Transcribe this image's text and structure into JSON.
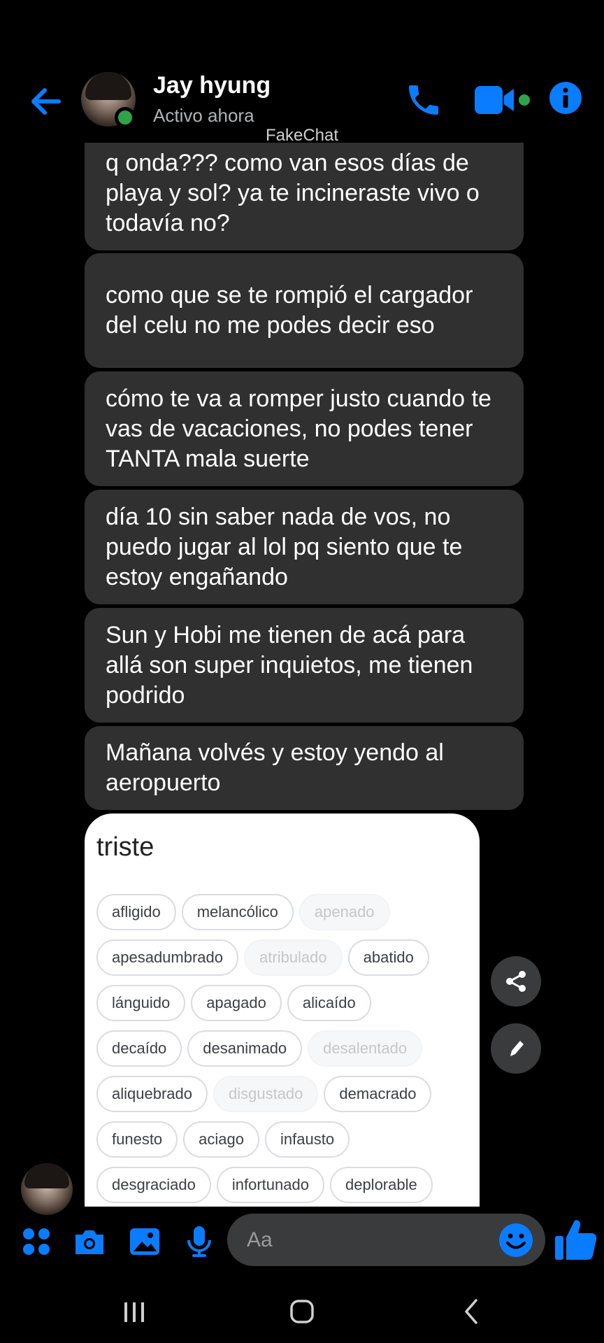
{
  "header": {
    "name": "Jay hyung",
    "status": "Activo ahora",
    "watermark": "FakeChat"
  },
  "messages": [
    {
      "text": "q onda??? como van esos días de playa y sol? ya te incineraste vivo o todavía no?"
    },
    {
      "text": "como que se te rompió el cargador del celu no me podes decir eso"
    },
    {
      "text": "cómo te va a romper justo cuando te vas de vacaciones, no podes tener TANTA mala suerte"
    },
    {
      "text": "día 10 sin saber nada de vos, no puedo jugar al lol pq siento que te estoy engañando"
    },
    {
      "text": "Sun y Hobi me tienen de acá para allá son super inquietos, me tienen podrido"
    },
    {
      "text": "Mañana volvés y estoy yendo al aeropuerto"
    }
  ],
  "card": {
    "title": "triste",
    "chips": [
      [
        "afligido",
        "melancólico",
        "apenado"
      ],
      [
        "apesadumbrado",
        "atribulado",
        "abatido"
      ],
      [
        "lánguido",
        "apagado",
        "alicaído"
      ],
      [
        "decaído",
        "desanimado",
        "desalentado"
      ],
      [
        "aliquebrado",
        "disgustado",
        "demacrado"
      ],
      [
        "funesto",
        "aciago",
        "infausto"
      ],
      [
        "desgraciado",
        "infortunado",
        "deplorable"
      ]
    ]
  },
  "composer": {
    "placeholder": "Aa"
  },
  "colors": {
    "accent": "#0a7cff",
    "bubble": "#303030",
    "online": "#31a24c"
  },
  "icons": [
    "back-arrow-icon",
    "phone-icon",
    "video-camera-icon",
    "info-icon",
    "share-icon",
    "pencil-icon",
    "menu-grid-icon",
    "camera-icon",
    "image-icon",
    "microphone-icon",
    "emoji-icon",
    "thumbs-up-icon",
    "recents-icon",
    "home-icon",
    "back-icon"
  ]
}
